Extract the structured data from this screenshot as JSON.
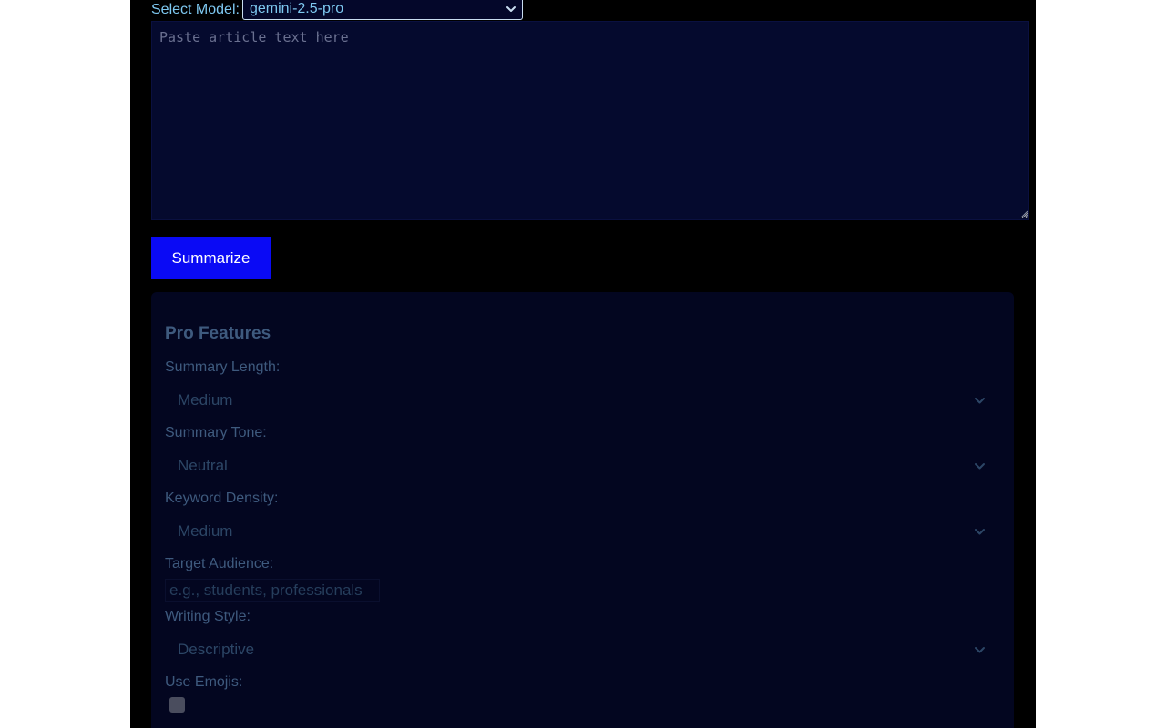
{
  "model": {
    "label": "Select Model:",
    "selected": "gemini-2.5-pro",
    "icon": "chevron-down-icon"
  },
  "article": {
    "placeholder": "Paste article text here",
    "value": ""
  },
  "summarize": {
    "label": "Summarize",
    "color": "#0a0af5"
  },
  "pro_features": {
    "title": "Pro Features",
    "summary_length": {
      "label": "Summary Length:",
      "selected": "Medium"
    },
    "summary_tone": {
      "label": "Summary Tone:",
      "selected": "Neutral"
    },
    "keyword_density": {
      "label": "Keyword Density:",
      "selected": "Medium"
    },
    "target_audience": {
      "label": "Target Audience:",
      "placeholder": "e.g., students, professionals",
      "value": ""
    },
    "writing_style": {
      "label": "Writing Style:",
      "selected": "Descriptive"
    },
    "use_emojis": {
      "label": "Use Emojis:",
      "checked": false
    }
  },
  "colors": {
    "page_background": "#000000",
    "accent_text": "#7ec8f0",
    "panel_background": "#030620",
    "muted_text": "#3e5a7e"
  }
}
